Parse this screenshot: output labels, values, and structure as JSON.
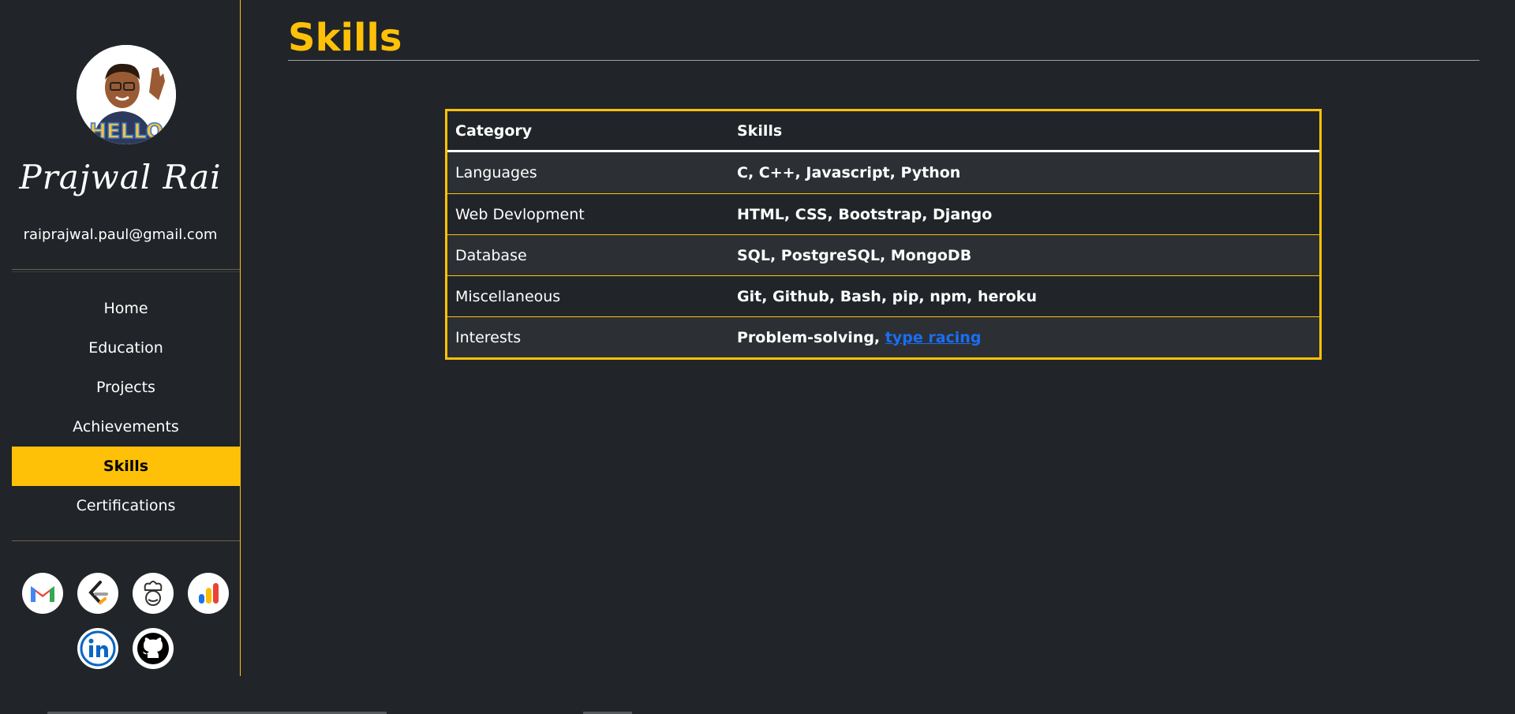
{
  "sidebar": {
    "name": "Prajwal Rai",
    "email": "raiprajwal.paul@gmail.com",
    "avatar_icon": "memoji-hello-avatar",
    "nav": [
      {
        "label": "Home",
        "active": false
      },
      {
        "label": "Education",
        "active": false
      },
      {
        "label": "Projects",
        "active": false
      },
      {
        "label": "Achievements",
        "active": false
      },
      {
        "label": "Skills",
        "active": true
      },
      {
        "label": "Certifications",
        "active": false
      }
    ],
    "socials": [
      "gmail-icon",
      "leetcode-icon",
      "codechef-icon",
      "google-analytics-icon",
      "linkedin-icon",
      "github-icon"
    ]
  },
  "main": {
    "title": "Skills",
    "table": {
      "headers": [
        "Category",
        "Skills"
      ],
      "rows": [
        {
          "category": "Languages",
          "skills": "C, C++, Javascript, Python"
        },
        {
          "category": "Web Devlopment",
          "skills": "HTML, CSS, Bootstrap, Django"
        },
        {
          "category": "Database",
          "skills": "SQL, PostgreSQL, MongoDB"
        },
        {
          "category": "Miscellaneous",
          "skills": "Git, Github, Bash, pip, npm, heroku"
        },
        {
          "category": "Interests",
          "skills": "Problem-solving, ",
          "link": "type racing"
        }
      ]
    }
  },
  "colors": {
    "accent": "#ffc107",
    "background": "#212529",
    "link": "#1a6ef5"
  }
}
